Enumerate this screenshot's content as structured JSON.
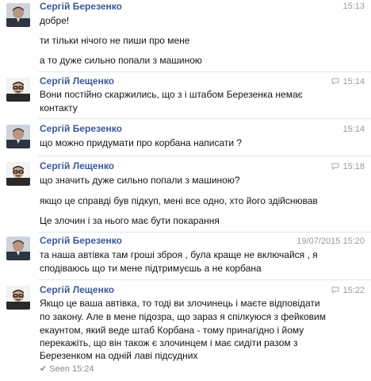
{
  "messages": [
    {
      "sender": "Сергій Березенко",
      "time": "15:13",
      "show_bubble": false,
      "avatar": "berezenko",
      "lines": [
        "добре!",
        "ти тільки нічого не пиши про мене",
        "а то дуже сильно попали з машиною"
      ]
    },
    {
      "sender": "Сергій Лещенко",
      "time": "15:14",
      "show_bubble": true,
      "avatar": "leshchenko",
      "lines": [
        "Вони постійно скаржились, що з  і штабом Березенка немає",
        "контакту"
      ]
    },
    {
      "sender": "Сергій Березенко",
      "time": "15:14",
      "show_bubble": false,
      "avatar": "berezenko",
      "lines": [
        "що можно придумати про корбана написати ?"
      ]
    },
    {
      "sender": "Сергій Лещенко",
      "time": "15:18",
      "show_bubble": true,
      "avatar": "leshchenko",
      "lines": [
        "що значить дуже сильно попали з машиною?",
        "якщо це справді був підкуп, мені все одно, хто його здійснював",
        "Це злочин і за нього має бути покарання"
      ]
    },
    {
      "sender": "Сергій Березенко",
      "time": "19/07/2015 15:20",
      "show_bubble": false,
      "avatar": "berezenko",
      "lines": [
        "та наша автівка там гроші зброя , була краще не включайся , я",
        "сподіваюсь що ти мене підтримуєшь а не корбана"
      ]
    },
    {
      "sender": "Сергій Лещенко",
      "time": "15:22",
      "show_bubble": true,
      "avatar": "leshchenko",
      "lines": [
        "Якщо це ваша автівка, то тоді ви злочинець і маєте відповідати",
        "по закону. Але в мене підозра, що зараз я спілкуюся з фейковим",
        "екаунтом, який веде штаб Корбана - тому принагідно і йому",
        "перекажіть, що він також є злочинцем і має сидіти разом з",
        "Березенком на одній лаві підсудних"
      ]
    }
  ],
  "seen": {
    "check": "✔",
    "text": "Seen 15:24"
  },
  "colors": {
    "sender": "#3b5998",
    "time": "#9a9a9a",
    "text": "#141414",
    "separator": "#e6e6e6"
  },
  "icons": {
    "time_bubble": "chat-bubble-icon",
    "seen": "checkmark-icon"
  }
}
